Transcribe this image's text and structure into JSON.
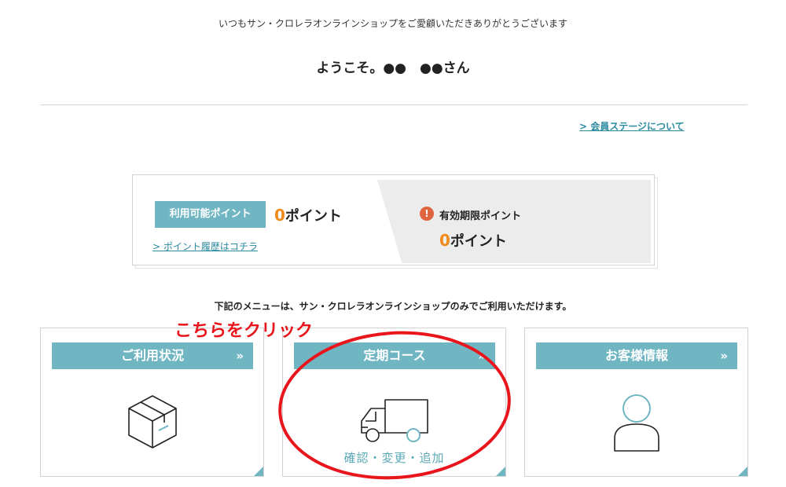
{
  "header": {
    "greeting": "いつもサン・クロレラオンラインショップをご愛顧いただきありがとうございます",
    "welcome": "ようこそ。●●　●●さん"
  },
  "stage_link": "> 会員ステージについて",
  "points": {
    "available_label": "利用可能ポイント",
    "available_number": "0",
    "available_unit": "ポイント",
    "history_link": "> ポイント履歴はコチラ",
    "expiring_label": "有効期限ポイント",
    "expiring_number": "0",
    "expiring_unit": "ポイント",
    "alert_glyph": "!"
  },
  "menu_note": "下記のメニューは、サン・クロレラオンラインショップのみでご利用いただけます。",
  "cards": [
    {
      "title": "ご利用状況",
      "arrow": "»",
      "icon": "box-icon",
      "sub": ""
    },
    {
      "title": "定期コース",
      "arrow": "»",
      "icon": "truck-icon",
      "sub": "確認・変更・追加"
    },
    {
      "title": "お客様情報",
      "arrow": "»",
      "icon": "person-icon",
      "sub": ""
    }
  ],
  "annotation": {
    "text": "こちらをクリック",
    "color": "#e8161c"
  },
  "colors": {
    "accent": "#6fb6c2",
    "link": "#2a8a9e",
    "points_number": "#f08a1c",
    "alert": "#e0643f"
  }
}
